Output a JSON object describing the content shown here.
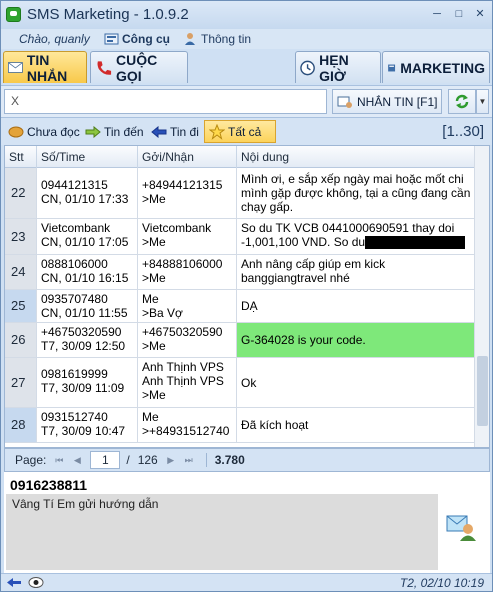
{
  "window": {
    "title": "SMS Marketing - 1.0.9.2",
    "controls": [
      "─",
      "□",
      "✕"
    ]
  },
  "user_menu": {
    "greeting": "Chào, quanly",
    "tools": "Công cụ",
    "info": "Thông tin"
  },
  "main_tabs": {
    "inbox": "TIN NHẮN",
    "calls": "CUỘC GỌI",
    "schedule": "HẸN GIỜ",
    "marketing": "MARKETING"
  },
  "search": {
    "value": "X",
    "send_button": "NHẮN TIN [F1]"
  },
  "filters": {
    "unread": "Chưa đọc",
    "incoming": "Tin đến",
    "outgoing": "Tin đi",
    "all": "Tất cả",
    "range": "[1..30]"
  },
  "table": {
    "headers": {
      "stt": "Stt",
      "number_time": "Số/Time",
      "from_to": "Gởi/Nhận",
      "content": "Nội dung"
    },
    "rows": [
      {
        "stt": "22",
        "number": "0944121315",
        "time": "CN, 01/10 17:33",
        "fromto": "+84944121315",
        "dir": ">Me",
        "content": "Mình ơi, e sắp xếp ngày mai hoặc mốt chi mình gặp được không, tại a cũng đang cần chạy gấp."
      },
      {
        "stt": "23",
        "number": "Vietcombank",
        "time": "CN, 01/10 17:05",
        "fromto": "Vietcombank",
        "dir": ">Me",
        "content": "So du TK VCB 0441000690591 thay doi -1,001,100 VND. So du"
      },
      {
        "stt": "24",
        "number": "0888106000",
        "time": "CN, 01/10 16:15",
        "fromto": "+84888106000",
        "dir": ">Me",
        "content": "Anh nâng cấp giúp em kick banggiangtravel nhé"
      },
      {
        "stt": "25",
        "number": "0935707480",
        "time": "CN, 01/10 11:55",
        "fromto": "Me",
        "dir": ">Ba Vợ",
        "content": "DẠ"
      },
      {
        "stt": "26",
        "number": "+46750320590",
        "time": "T7, 30/09 12:50",
        "fromto": "+46750320590",
        "dir": ">Me",
        "content": "G-364028 is your code."
      },
      {
        "stt": "27",
        "number": "0981619999",
        "time": "T7, 30/09 11:09",
        "fromto": "Anh Thịnh VPS",
        "fromto2": "Anh Thịnh VPS",
        "dir": ">Me",
        "content": "Ok"
      },
      {
        "stt": "28",
        "number": "0931512740",
        "time": "T7, 30/09 10:47",
        "fromto": "Me",
        "dir": ">+84931512740",
        "content": "Đã kích hoạt"
      }
    ]
  },
  "pager": {
    "label": "Page:",
    "current": "1",
    "separator": "/",
    "total": "126",
    "count": "3.780"
  },
  "detail": {
    "number": "0916238811",
    "message": "Vâng Tí Em gửi hướng dẫn"
  },
  "status": {
    "time": "T2, 02/10 10:19"
  },
  "colors": {
    "highlight_row": "#7ee87a",
    "active_tab": "#fcd35b",
    "frame": "#cfe0f3"
  }
}
